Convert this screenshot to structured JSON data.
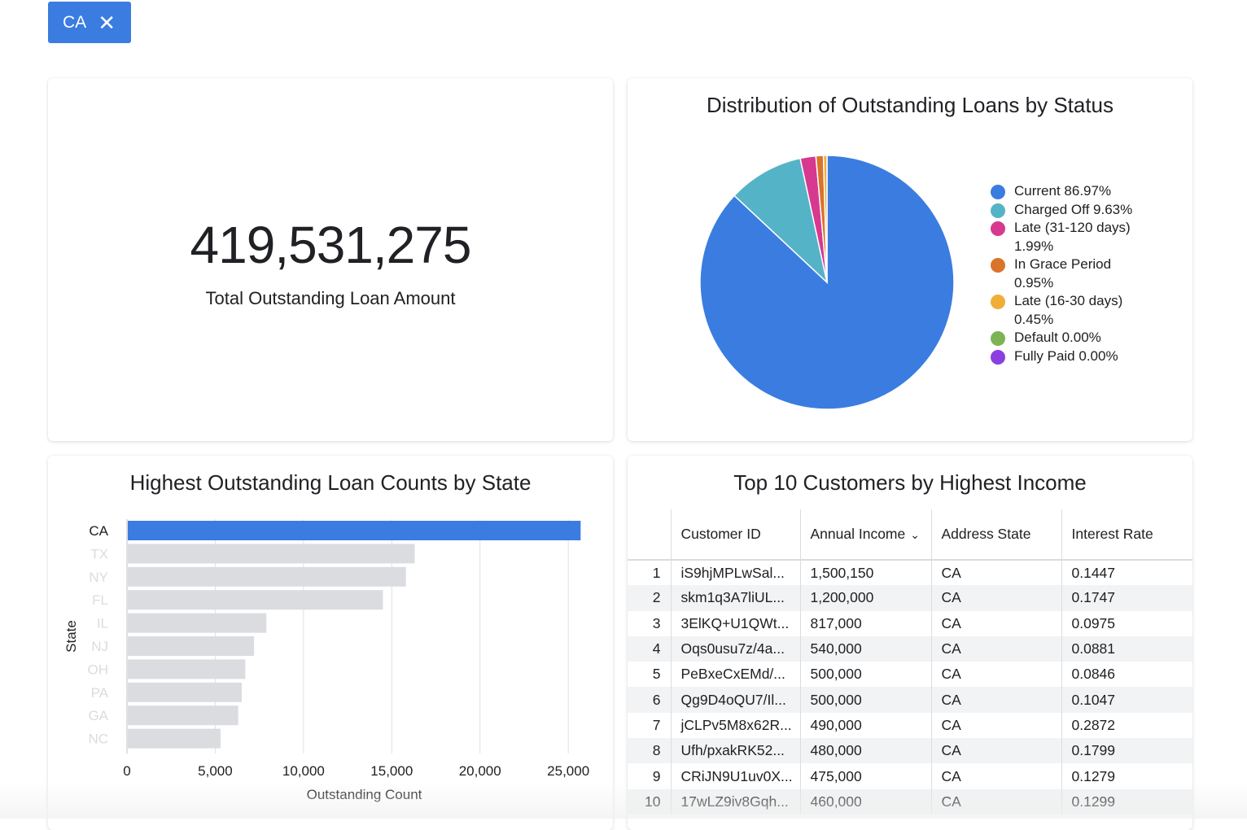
{
  "filter": {
    "label": "CA",
    "close_icon": "close-icon"
  },
  "total_card": {
    "value": "419,531,275",
    "label": "Total Outstanding Loan Amount"
  },
  "pie_card": {
    "title": "Distribution of Outstanding Loans by Status",
    "legend": [
      {
        "label": "Current 86.97%",
        "color": "#3b7ce0"
      },
      {
        "label": "Charged Off 9.63%",
        "color": "#55b3c8"
      },
      {
        "label": "Late (31-120 days) 1.99%",
        "color": "#d6398f"
      },
      {
        "label": "In Grace Period 0.95%",
        "color": "#d9742b"
      },
      {
        "label": "Late (16-30 days) 0.45%",
        "color": "#f0ad38"
      },
      {
        "label": "Default 0.00%",
        "color": "#7cb455"
      },
      {
        "label": "Fully Paid 0.00%",
        "color": "#8c3fe0"
      }
    ]
  },
  "bar_card": {
    "title": "Highest Outstanding Loan Counts by State"
  },
  "table_card": {
    "title": "Top 10 Customers by Highest Income",
    "columns": [
      "Customer ID",
      "Annual Income",
      "Address State",
      "Interest Rate"
    ],
    "sort_icon": "chevron-down-icon",
    "rows": [
      {
        "n": "1",
        "id": "iS9hjMPLwSal...",
        "income": "1,500,150",
        "state": "CA",
        "rate": "0.1447"
      },
      {
        "n": "2",
        "id": "skm1q3A7liUL...",
        "income": "1,200,000",
        "state": "CA",
        "rate": "0.1747"
      },
      {
        "n": "3",
        "id": "3ElKQ+U1QWt...",
        "income": "817,000",
        "state": "CA",
        "rate": "0.0975"
      },
      {
        "n": "4",
        "id": "Oqs0usu7z/4a...",
        "income": "540,000",
        "state": "CA",
        "rate": "0.0881"
      },
      {
        "n": "5",
        "id": "PeBxeCxEMd/...",
        "income": "500,000",
        "state": "CA",
        "rate": "0.0846"
      },
      {
        "n": "6",
        "id": "Qg9D4oQU7/Il...",
        "income": "500,000",
        "state": "CA",
        "rate": "0.1047"
      },
      {
        "n": "7",
        "id": "jCLPv5M8x62R...",
        "income": "490,000",
        "state": "CA",
        "rate": "0.2872"
      },
      {
        "n": "8",
        "id": "Ufh/pxakRK52...",
        "income": "480,000",
        "state": "CA",
        "rate": "0.1799"
      },
      {
        "n": "9",
        "id": "CRiJN9U1uv0X...",
        "income": "475,000",
        "state": "CA",
        "rate": "0.1279"
      },
      {
        "n": "10",
        "id": "17wLZ9iv8Gqh...",
        "income": "460,000",
        "state": "CA",
        "rate": "0.1299"
      }
    ]
  },
  "chart_data": [
    {
      "type": "pie",
      "title": "Distribution of Outstanding Loans by Status",
      "labels": [
        "Current",
        "Charged Off",
        "Late (31-120 days)",
        "In Grace Period",
        "Late (16-30 days)",
        "Default",
        "Fully Paid"
      ],
      "values": [
        86.97,
        9.63,
        1.99,
        0.95,
        0.45,
        0.0,
        0.0
      ],
      "colors": [
        "#3b7ce0",
        "#55b3c8",
        "#d6398f",
        "#d9742b",
        "#f0ad38",
        "#7cb455",
        "#8c3fe0"
      ],
      "legend": "right"
    },
    {
      "type": "bar",
      "orientation": "horizontal",
      "title": "Highest Outstanding Loan Counts by State",
      "categories": [
        "CA",
        "TX",
        "NY",
        "FL",
        "IL",
        "NJ",
        "OH",
        "PA",
        "GA",
        "NC"
      ],
      "values": [
        25700,
        16300,
        15800,
        14500,
        7900,
        7200,
        6700,
        6500,
        6300,
        5300
      ],
      "highlight": "CA",
      "highlight_color": "#3b7ce0",
      "muted_color": "#dadce0",
      "xlabel": "Outstanding Count",
      "ylabel": "State",
      "xlim": [
        0,
        25500
      ],
      "xticks": [
        0,
        5000,
        10000,
        15000,
        20000,
        25000
      ],
      "xtick_labels": [
        "0",
        "5,000",
        "10,000",
        "15,000",
        "20,000",
        "25,000"
      ],
      "grid": true
    }
  ]
}
